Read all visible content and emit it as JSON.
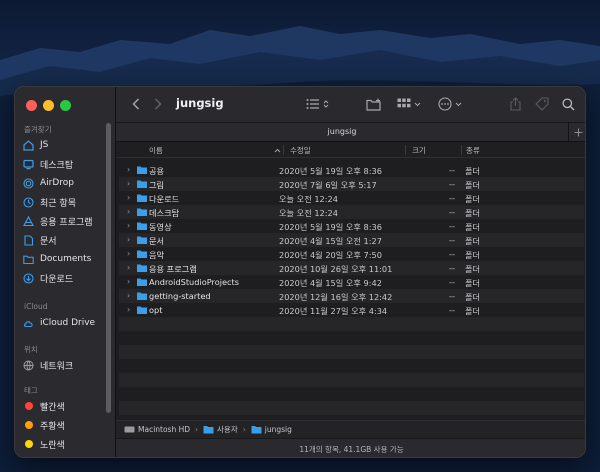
{
  "window": {
    "title": "jungsig",
    "tab_title": "jungsig"
  },
  "sidebar": {
    "favorites_label": "즐겨찾기",
    "favorites": [
      {
        "label": "JS",
        "icon": "home-folder-icon"
      },
      {
        "label": "데스크탑",
        "icon": "desktop-icon"
      },
      {
        "label": "AirDrop",
        "icon": "airdrop-icon"
      },
      {
        "label": "최근 항목",
        "icon": "clock-icon"
      },
      {
        "label": "응용 프로그램",
        "icon": "applications-icon"
      },
      {
        "label": "문서",
        "icon": "document-icon"
      },
      {
        "label": "Documents",
        "icon": "folder-icon"
      },
      {
        "label": "다운로드",
        "icon": "download-icon"
      }
    ],
    "icloud_label": "iCloud",
    "icloud": [
      {
        "label": "iCloud Drive",
        "icon": "cloud-icon"
      }
    ],
    "locations_label": "위치",
    "locations": [
      {
        "label": "네트워크",
        "icon": "network-globe-icon"
      }
    ],
    "tags_label": "태그",
    "tags": [
      {
        "label": "빨간색",
        "color": "#ff453a"
      },
      {
        "label": "주황색",
        "color": "#ff9f0a"
      },
      {
        "label": "노란색",
        "color": "#ffd60a"
      }
    ]
  },
  "columns": {
    "name": "이름",
    "date": "수정일",
    "size": "크기",
    "kind": "종류"
  },
  "files": [
    {
      "name": "공용",
      "date": "2020년 5월 19일 오후 8:36",
      "size": "--",
      "kind": "폴더"
    },
    {
      "name": "그림",
      "date": "2020년 7월 6일 오후 5:17",
      "size": "--",
      "kind": "폴더"
    },
    {
      "name": "다운로드",
      "date": "오늘 오전 12:24",
      "size": "--",
      "kind": "폴더"
    },
    {
      "name": "데스크탑",
      "date": "오늘 오전 12:24",
      "size": "--",
      "kind": "폴더"
    },
    {
      "name": "동영상",
      "date": "2020년 5월 19일 오후 8:36",
      "size": "--",
      "kind": "폴더"
    },
    {
      "name": "문서",
      "date": "2020년 4월 15일 오전 1:27",
      "size": "--",
      "kind": "폴더"
    },
    {
      "name": "음악",
      "date": "2020년 4월 20일 오후 7:50",
      "size": "--",
      "kind": "폴더"
    },
    {
      "name": "응용 프로그램",
      "date": "2020년 10월 26일 오후 11:01",
      "size": "--",
      "kind": "폴더"
    },
    {
      "name": "AndroidStudioProjects",
      "date": "2020년 4월 15일 오후 9:42",
      "size": "--",
      "kind": "폴더"
    },
    {
      "name": "getting-started",
      "date": "2020년 12월 16일 오후 12:42",
      "size": "--",
      "kind": "폴더"
    },
    {
      "name": "opt",
      "date": "2020년 11월 27일 오후 4:34",
      "size": "--",
      "kind": "폴더"
    }
  ],
  "pathbar": {
    "disk": "Macintosh HD",
    "users": "사용자",
    "home": "jungsig"
  },
  "status": {
    "text": "11개의 항목, 41.1GB 사용 가능"
  },
  "colors": {
    "accent": "#0a84ff",
    "folder": "#3b9eea"
  }
}
